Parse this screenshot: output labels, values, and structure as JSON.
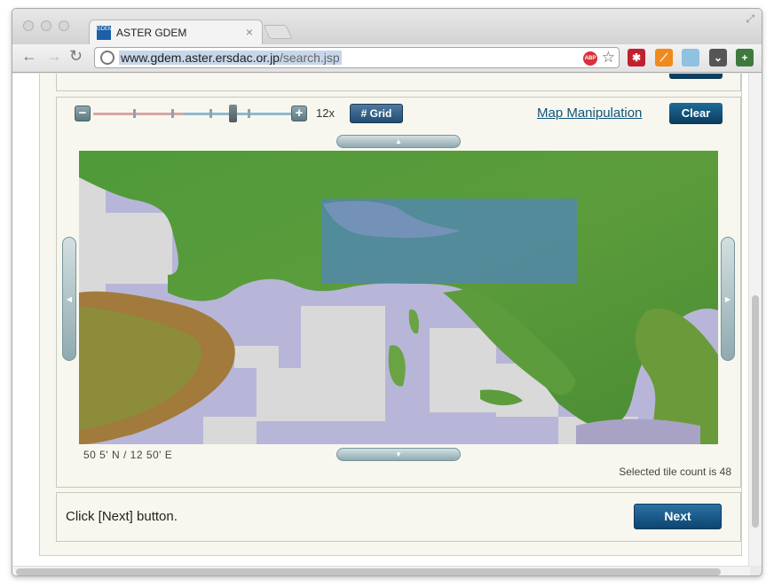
{
  "browser": {
    "tab_title": "ASTER GDEM",
    "favicon_text": "GDEM",
    "url_domain": "www.gdem.aster.ersdac.or.jp",
    "url_path": "/search.jsp",
    "abp_label": "ABP"
  },
  "map_tools": {
    "zoom_level": "12x",
    "zoom_minus": "−",
    "zoom_plus": "+",
    "grid_label": "# Grid",
    "manipulation_link": "Map Manipulation",
    "clear_label": "Clear"
  },
  "map": {
    "coords": "50 5' N /  12 50' E",
    "selected_count_text": "Selected tile count is 48",
    "selection_color": "#4f80d8"
  },
  "footer": {
    "instruction": "Click [Next] button.",
    "next_label": "Next"
  }
}
